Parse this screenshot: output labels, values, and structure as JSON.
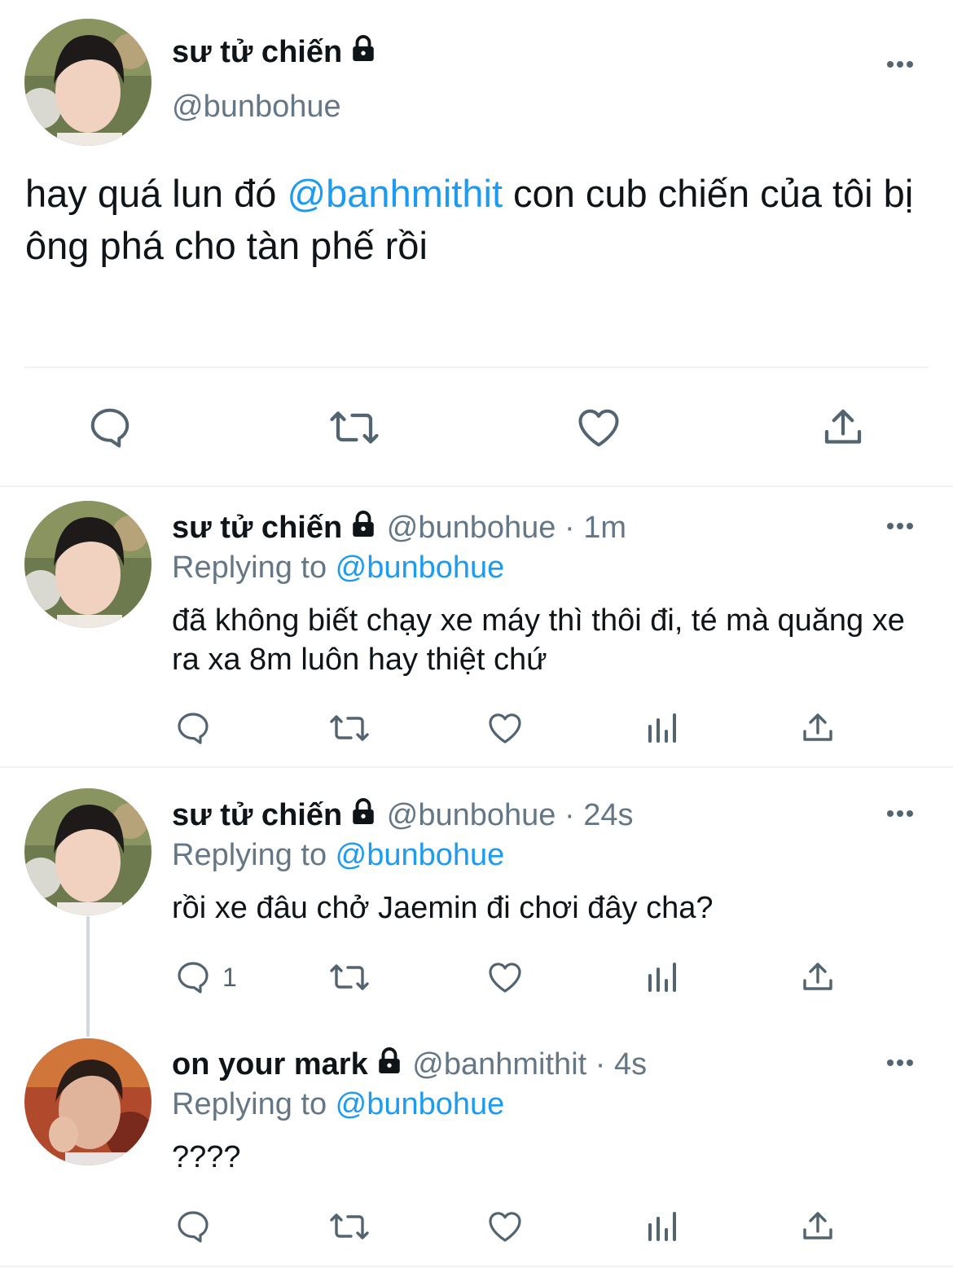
{
  "main_tweet": {
    "display_name": "sư tử chiến",
    "handle": "@bunbohue",
    "text_before": "hay quá lun đó ",
    "mention": "@banhmithit",
    "text_after": " con cub chiến của tôi bị ông phá cho tàn phế rồi"
  },
  "replies": [
    {
      "display_name": "sư tử chiến",
      "handle": "@bunbohue",
      "separator": " · ",
      "time": "1m",
      "replying_label": "Replying to ",
      "replying_to": "@bunbohue",
      "text": "đã không biết chạy xe máy thì thôi đi, té mà quăng xe ra xa 8m luôn hay thiệt chứ",
      "reply_count": ""
    },
    {
      "display_name": "sư tử chiến",
      "handle": "@bunbohue",
      "separator": " · ",
      "time": "24s",
      "replying_label": "Replying to ",
      "replying_to": "@bunbohue",
      "text": "rồi xe đâu chở Jaemin đi chơi đây cha?",
      "reply_count": "1"
    },
    {
      "display_name": "on your mark",
      "handle": "@banhmithit",
      "separator": " · ",
      "time": "4s",
      "replying_label": "Replying to ",
      "replying_to": "@bunbohue",
      "text": "????",
      "reply_count": ""
    }
  ],
  "colors": {
    "link": "#1d9bf0",
    "muted": "#657786",
    "icon": "#536471",
    "divider": "#eff3f4"
  }
}
